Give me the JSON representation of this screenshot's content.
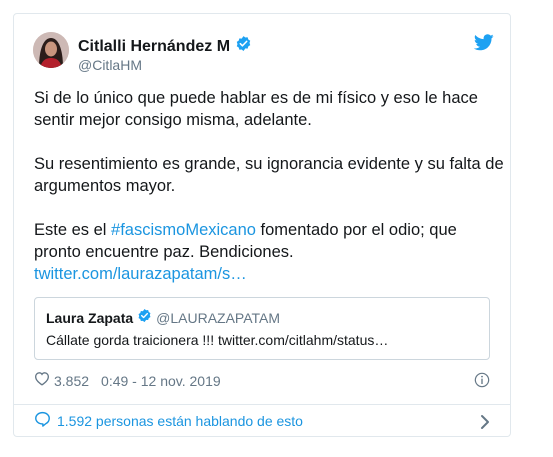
{
  "tweet": {
    "author_name": "Citlalli Hernández M",
    "author_handle": "@CitlaHM",
    "paragraphs": [
      "Si de lo único que puede hablar es de mi físico y eso le hace sentir mejor consigo misma, adelante.",
      "Su resentimiento es grande, su ignorancia evidente y su falta de argumentos mayor."
    ],
    "last_paragraph": {
      "before": "Este es el ",
      "hashtag": "#fascismoMexicano",
      "after": " fomentado por el odio; que pronto encuentre paz. Bendiciones.",
      "link": "twitter.com/laurazapatam/s…"
    },
    "likes": "3.852",
    "timestamp": "0:49 - 12 nov. 2019",
    "conversation": "1.592 personas están hablando de esto"
  },
  "quoted": {
    "name": "Laura Zapata",
    "handle": "@LAURAZAPATAM",
    "text": "Cállate gorda traicionera !!! twitter.com/citlahm/status…"
  },
  "colors": {
    "accent": "#1b95e0",
    "verified": "#1da1f2",
    "secondary_text": "#657786",
    "border": "#e1e8ed"
  },
  "icons": {
    "verified": "verified-badge-icon",
    "bird": "twitter-bird-icon",
    "like": "heart-icon",
    "info": "info-icon",
    "conversation": "speech-bubble-icon",
    "chevron": "chevron-right-icon"
  }
}
